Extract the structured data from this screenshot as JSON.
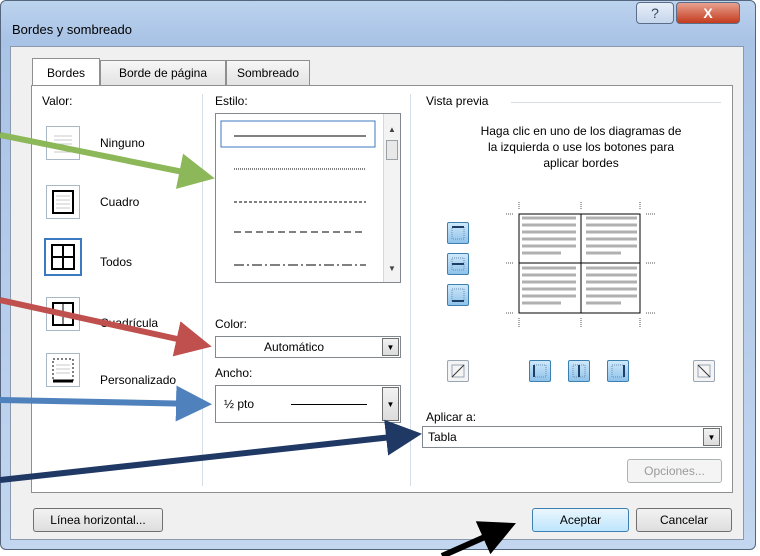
{
  "window": {
    "title": "Bordes y sombreado",
    "help_glyph": "?",
    "close_glyph": "X"
  },
  "tabs": [
    {
      "label": "Bordes"
    },
    {
      "label": "Borde de página"
    },
    {
      "label": "Sombreado"
    }
  ],
  "valor": {
    "label": "Valor:",
    "settings": [
      {
        "label": "Ninguno",
        "icon": "setting-none-icon"
      },
      {
        "label": "Cuadro",
        "icon": "setting-box-icon"
      },
      {
        "label": "Todos",
        "icon": "setting-all-icon",
        "selected": true
      },
      {
        "label": "Cuadrícula",
        "icon": "setting-grid-icon"
      },
      {
        "label": "Personalizado",
        "icon": "setting-custom-icon"
      }
    ]
  },
  "estilo": {
    "label": "Estilo:"
  },
  "color": {
    "label": "Color:",
    "value": "Automático"
  },
  "ancho": {
    "label": "Ancho:",
    "value": "½ pto"
  },
  "preview": {
    "label": "Vista previa",
    "hint": "Haga clic en uno de los diagramas de la izquierda o use los botones para aplicar bordes"
  },
  "aplicar": {
    "label": "Aplicar a:",
    "value": "Tabla"
  },
  "buttons": {
    "options": "Opciones...",
    "horizontal_line": "Línea horizontal...",
    "ok": "Aceptar",
    "cancel": "Cancelar"
  },
  "colors": {
    "accent": "#3b79c2",
    "arrow_green": "#8db85a",
    "arrow_red": "#c0504d",
    "arrow_blue": "#4f81bd",
    "arrow_navy": "#1f3864",
    "arrow_black": "#000000"
  }
}
